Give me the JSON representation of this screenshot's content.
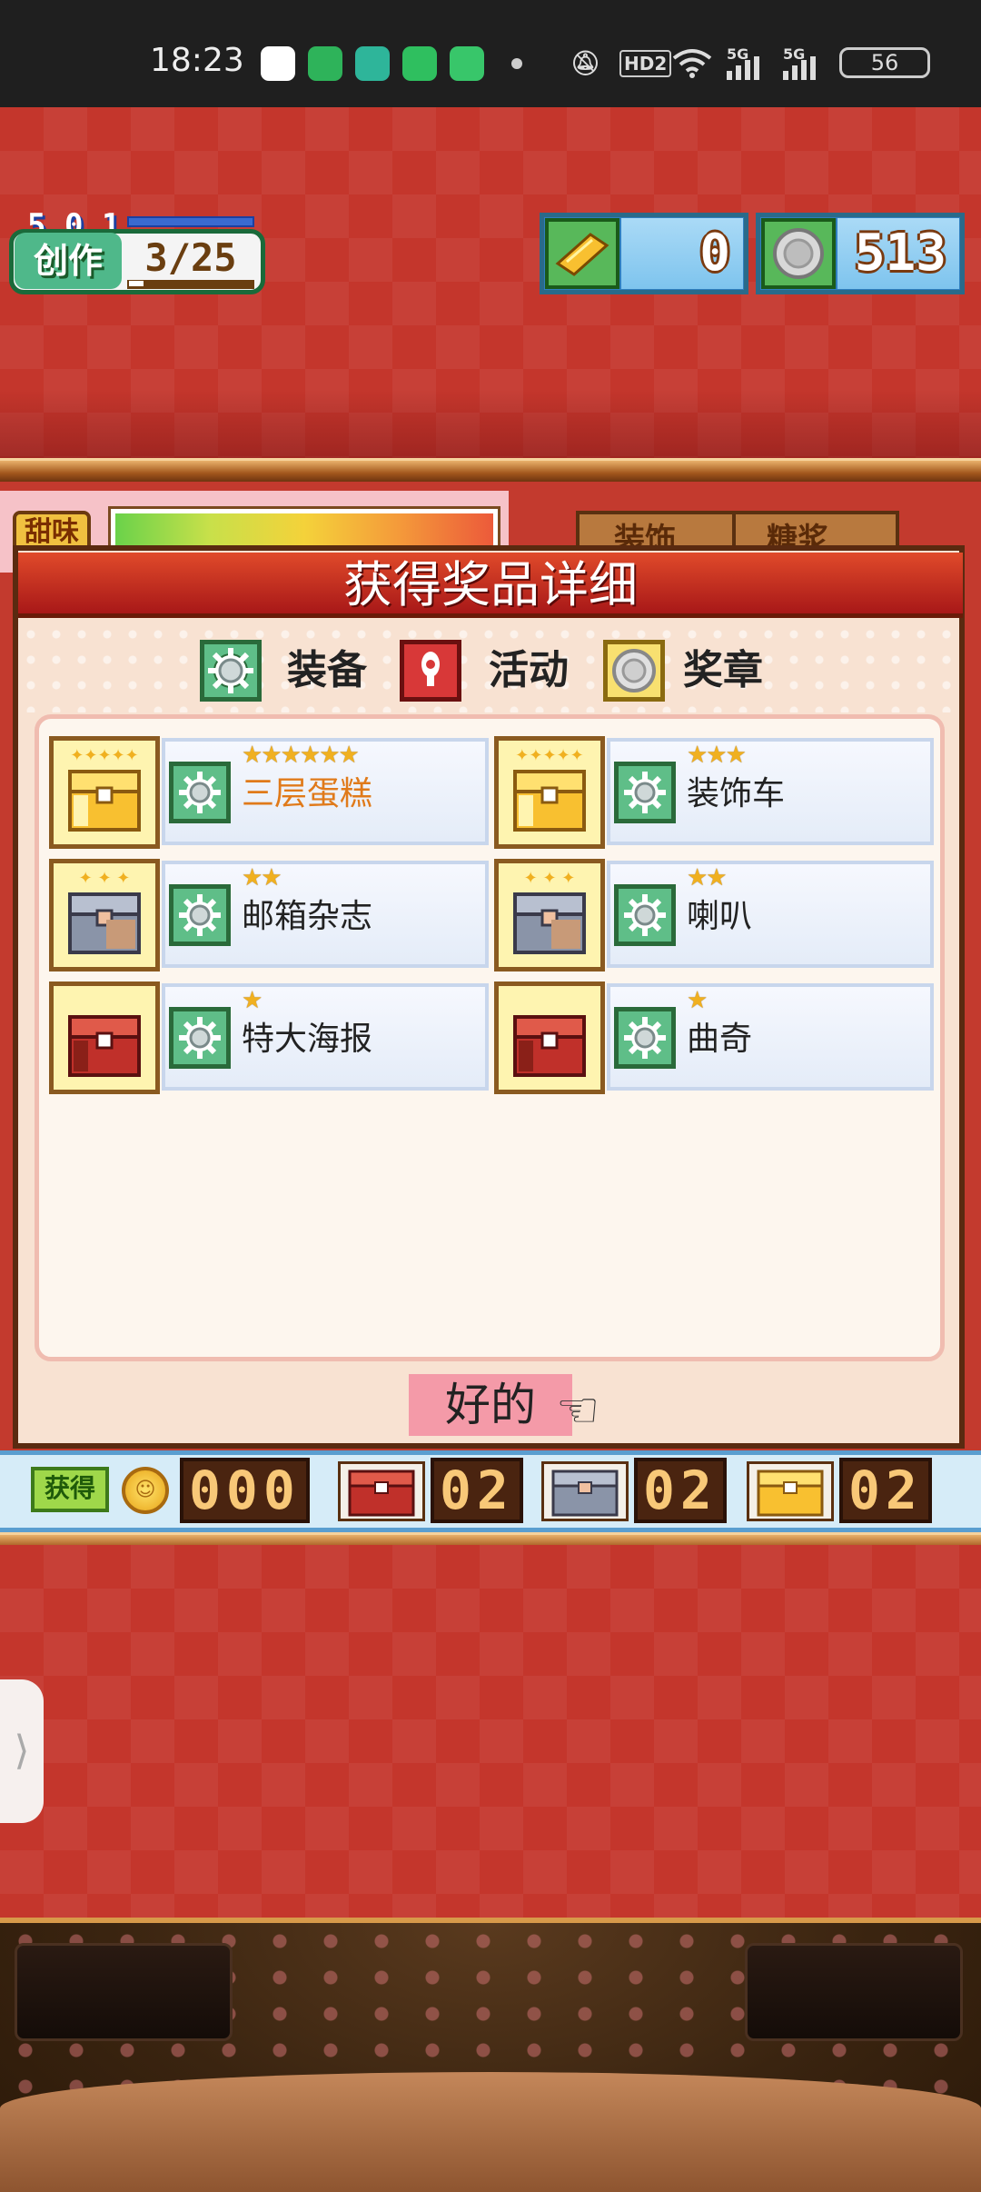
{
  "status_bar": {
    "time": "18:23",
    "hd_label": "HD2",
    "network_1": "5G",
    "network_2": "5G",
    "battery": "56"
  },
  "hud": {
    "level": "5 0 1",
    "create_label": "创作",
    "create_count": "3/25",
    "create_progress": 0.12,
    "ticket_value": "0",
    "medal_value": "513"
  },
  "background": {
    "sweet_tag": "甜味",
    "tab_1": "装饰",
    "tab_2": "糖浆"
  },
  "dialog": {
    "title": "获得奖品详细",
    "legend": [
      {
        "icon": "gear-icon",
        "label": "装备"
      },
      {
        "icon": "exclamation-icon",
        "label": "活动"
      },
      {
        "icon": "medal-icon",
        "label": "奖章"
      }
    ],
    "prizes": [
      {
        "name": "三层蛋糕",
        "stars": "★★★★★★",
        "chest": "gold",
        "highlight": true
      },
      {
        "name": "装饰车",
        "stars": "★★★",
        "chest": "gold",
        "highlight": false
      },
      {
        "name": "邮箱杂志",
        "stars": "★★",
        "chest": "silver",
        "highlight": false
      },
      {
        "name": "喇叭",
        "stars": "★★",
        "chest": "silver",
        "highlight": false
      },
      {
        "name": "特大海报",
        "stars": "★",
        "chest": "bronze",
        "highlight": false
      },
      {
        "name": "曲奇",
        "stars": "★",
        "chest": "bronze",
        "highlight": false
      }
    ],
    "ok_label": "好的"
  },
  "score_bar": {
    "obtained_label": "获得",
    "coin_count": "000",
    "bronze_count": "02",
    "silver_count": "02",
    "gold_count": "02"
  },
  "colors": {
    "accent_red": "#b8302a",
    "gold_chest": "#f8c030",
    "silver_chest": "#8a94a8",
    "bronze_chest": "#c0302a",
    "highlight_text": "#e07a1a"
  }
}
